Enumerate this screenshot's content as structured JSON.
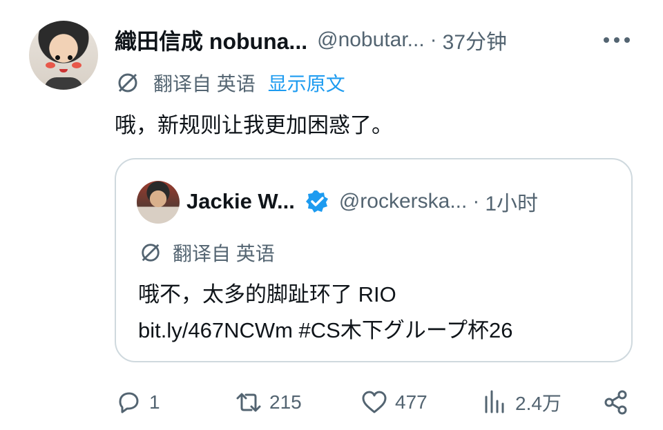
{
  "author": {
    "name": "織田信成 nobuna...",
    "handle": "@nobutar...",
    "separator": "·",
    "time": "37分钟"
  },
  "translation": {
    "label": "翻译自 英语",
    "show_original": "显示原文"
  },
  "tweet": {
    "text": "哦，新规则让我更加困惑了。"
  },
  "quoted": {
    "name": "Jackie W...",
    "handle": "@rockerska...",
    "separator": "·",
    "time": "1小时",
    "translation_label": "翻译自 英语",
    "line1": "哦不，太多的脚趾环了 RIO",
    "line2": "bit.ly/467NCWm #CS木下グループ杯26"
  },
  "actions": {
    "replies": "1",
    "retweets": "215",
    "likes": "477",
    "views": "2.4万"
  },
  "colors": {
    "text": "#0f1419",
    "secondary": "#536471",
    "link": "#1d9bf0",
    "border": "#cfd9de"
  },
  "icons": [
    "translate-icon",
    "more-icon",
    "verified-badge-icon",
    "reply-icon",
    "retweet-icon",
    "like-icon",
    "views-icon",
    "share-icon"
  ]
}
